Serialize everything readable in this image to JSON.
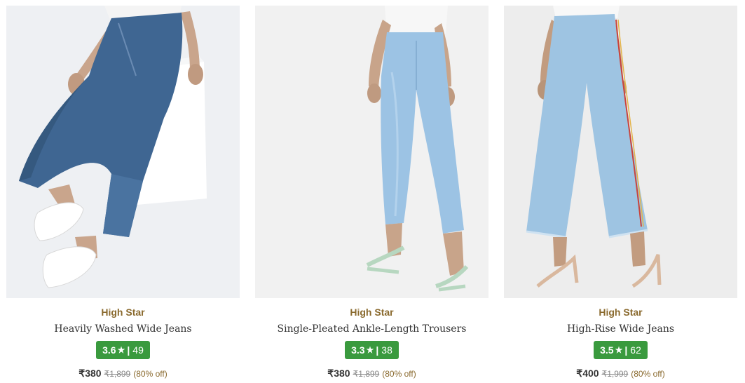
{
  "products": [
    {
      "brand": "High Star",
      "name": "Heavily Washed Wide Jeans",
      "rating": "3.6",
      "rating_count": "49",
      "price": "₹380",
      "mrp": "₹1,899",
      "discount": "(80% off)",
      "image_icon": "dark-blue-wide-jeans-photo"
    },
    {
      "brand": "High Star",
      "name": "Single-Pleated Ankle-Length Trousers",
      "rating": "3.3",
      "rating_count": "38",
      "price": "₹380",
      "mrp": "₹1,899",
      "discount": "(80% off)",
      "image_icon": "light-blue-trousers-photo"
    },
    {
      "brand": "High Star",
      "name": "High-Rise Wide Jeans",
      "rating": "3.5",
      "rating_count": "62",
      "price": "₹400",
      "mrp": "₹1,999",
      "discount": "(80% off)",
      "image_icon": "light-blue-wide-jeans-photo"
    }
  ],
  "colors": {
    "brand_text": "#8a6a2e",
    "rating_badge": "#3a9a3e",
    "dark_denim": "#3f6692",
    "light_denim": "#9cc3e4"
  }
}
